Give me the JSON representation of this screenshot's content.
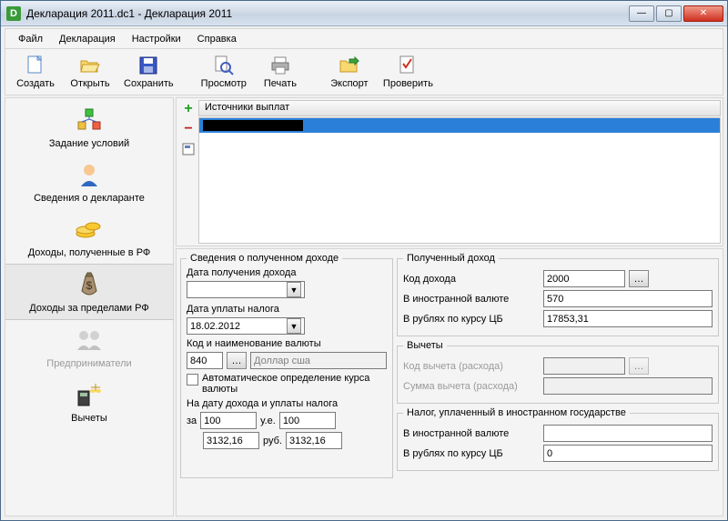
{
  "window": {
    "title": "Декларация 2011.dc1 - Декларация 2011",
    "app_glyph": "D"
  },
  "menu": {
    "file": "Файл",
    "decl": "Декларация",
    "settings": "Настройки",
    "help": "Справка"
  },
  "toolbar": {
    "create": "Создать",
    "open": "Открыть",
    "save": "Сохранить",
    "preview": "Просмотр",
    "print": "Печать",
    "export": "Экспорт",
    "check": "Проверить"
  },
  "sidebar": {
    "items": [
      {
        "label": "Задание условий"
      },
      {
        "label": "Сведения о декларанте"
      },
      {
        "label": "Доходы, полученные в РФ"
      },
      {
        "label": "Доходы за пределами РФ"
      },
      {
        "label": "Предприниматели"
      },
      {
        "label": "Вычеты"
      }
    ]
  },
  "sources": {
    "header": "Источники выплат"
  },
  "income_received": {
    "legend": "Сведения о полученном доходе",
    "date_received_label": "Дата получения дохода",
    "date_received_value": "",
    "date_tax_label": "Дата уплаты налога",
    "date_tax_value": "18.02.2012",
    "currency_label": "Код и наименование валюты",
    "currency_code": "840",
    "currency_name": "Доллар сша",
    "auto_rate_label": "Автоматическое определение курса валюты",
    "rate_on_date_label": "На дату дохода и уплаты налога",
    "za": "за",
    "ue": "у.е.",
    "rub": "руб.",
    "rate_per": "100",
    "rate_ue": "100",
    "rate_val1": "3132,16",
    "rate_val2": "3132,16"
  },
  "received_income": {
    "legend": "Полученный доход",
    "code_label": "Код дохода",
    "code_value": "2000",
    "foreign_label": "В иностранной валюте",
    "foreign_value": "570",
    "rub_label": "В рублях по курсу ЦБ",
    "rub_value": "17853,31"
  },
  "deductions": {
    "legend": "Вычеты",
    "code_label": "Код вычета (расхода)",
    "sum_label": "Сумма вычета (расхода)"
  },
  "tax_paid": {
    "legend": "Налог, уплаченный в иностранном государстве",
    "foreign_label": "В иностранной валюте",
    "foreign_value": "",
    "rub_label": "В рублях по курсу ЦБ",
    "rub_value": "0"
  }
}
